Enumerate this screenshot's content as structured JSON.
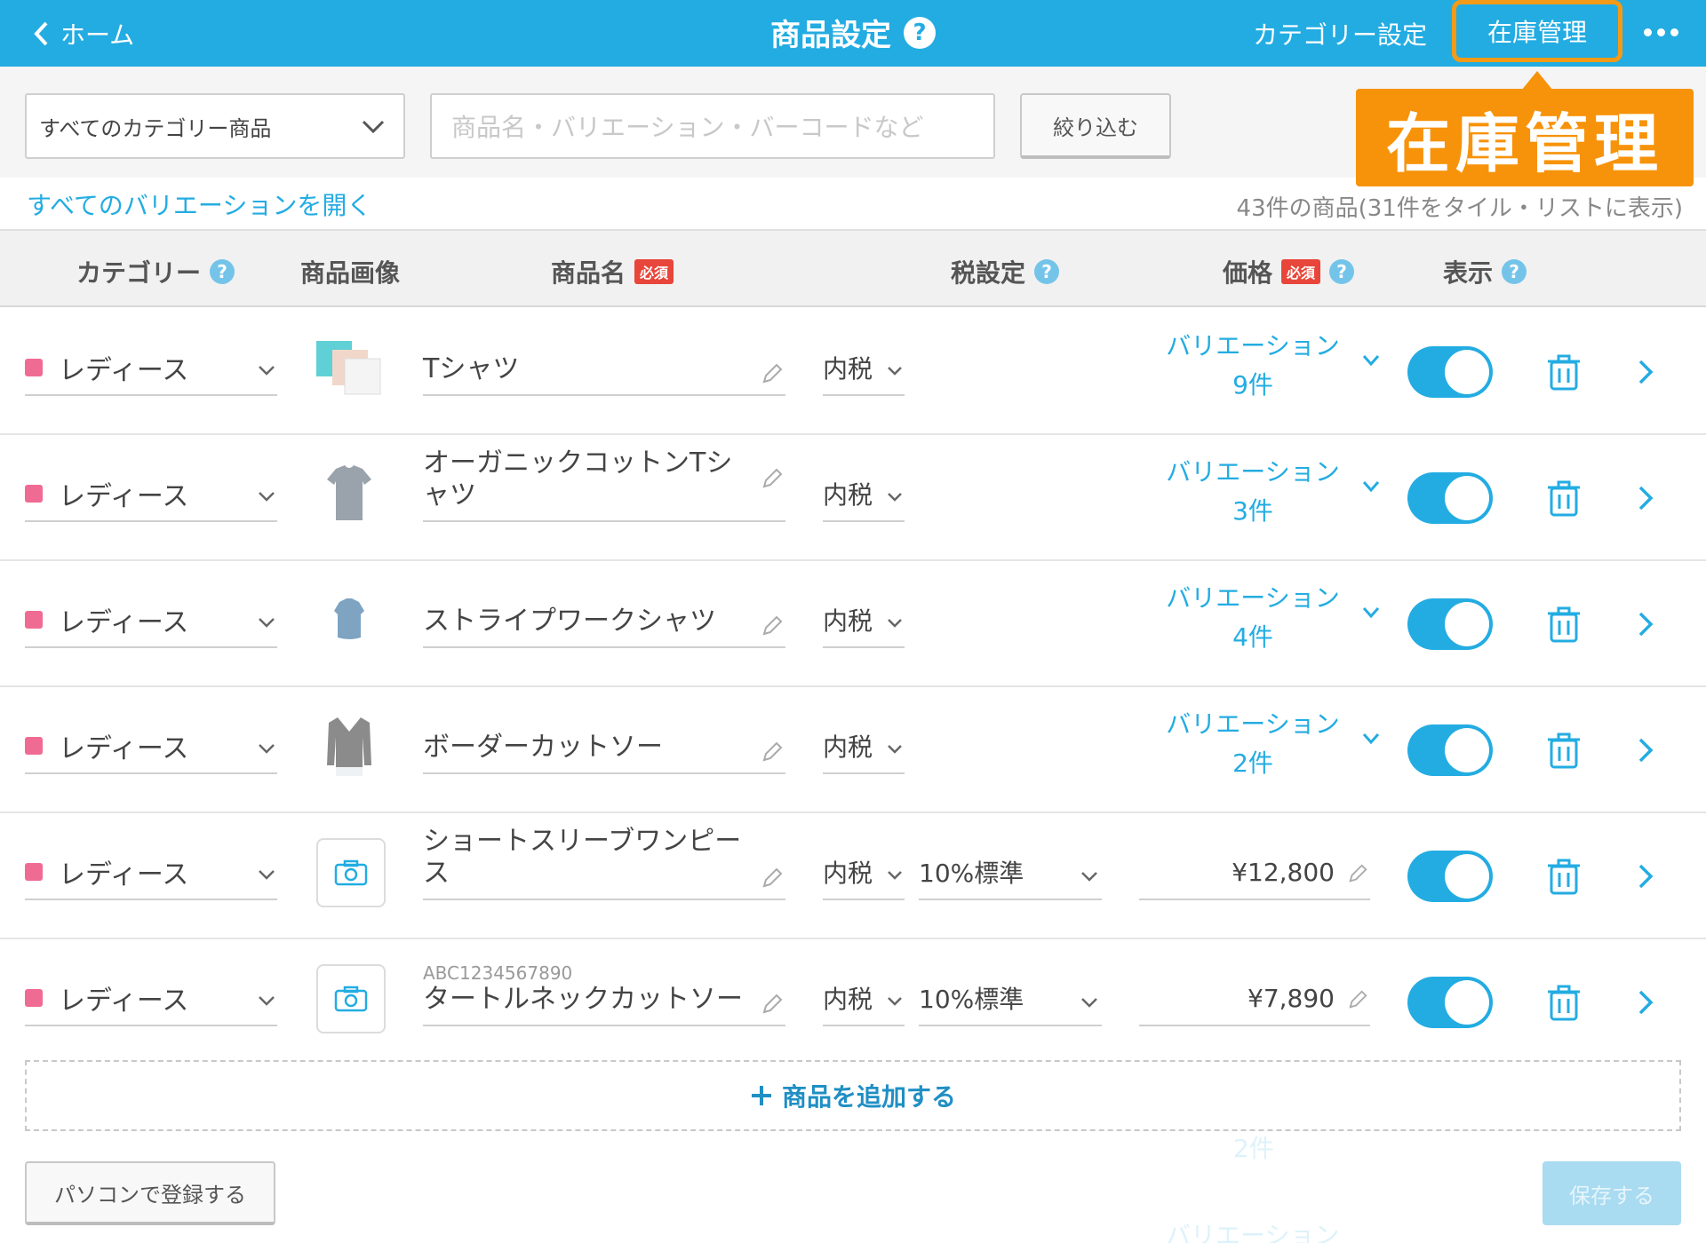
{
  "header": {
    "back_label": "ホーム",
    "title": "商品設定",
    "help": "?",
    "category_settings": "カテゴリー設定",
    "stock_management": "在庫管理"
  },
  "callout": {
    "text": "在庫管理"
  },
  "filter": {
    "category_select": "すべてのカテゴリー商品",
    "search_placeholder": "商品名・バリエーション・バーコードなど",
    "filter_button": "絞り込む"
  },
  "open_all_variations": "すべてのバリエーションを開く",
  "product_count": "43件の商品(31件をタイル・リストに表示)",
  "columns": {
    "category": "カテゴリー",
    "image": "商品画像",
    "name": "商品名",
    "tax": "税設定",
    "price": "価格",
    "display": "表示",
    "required": "必須",
    "help": "?"
  },
  "rows": [
    {
      "category": "レディース",
      "name": "Tシャツ",
      "tax": "内税",
      "variation_label": "バリエーション",
      "variation_count": "9件"
    },
    {
      "category": "レディース",
      "name": "オーガニックコットンTシャツ",
      "tax": "内税",
      "variation_label": "バリエーション",
      "variation_count": "3件"
    },
    {
      "category": "レディース",
      "name": "ストライプワークシャツ",
      "tax": "内税",
      "variation_label": "バリエーション",
      "variation_count": "4件"
    },
    {
      "category": "レディース",
      "name": "ボーダーカットソー",
      "tax": "内税",
      "variation_label": "バリエーション",
      "variation_count": "2件"
    },
    {
      "category": "レディース",
      "name": "ショートスリーブワンピース",
      "tax": "内税",
      "tax_rate": "10%標準",
      "price": "¥12,800"
    },
    {
      "category": "レディース",
      "barcode": "ABC1234567890",
      "name": "タートルネックカットソー",
      "tax": "内税",
      "tax_rate": "10%標準",
      "price": "¥7,890"
    }
  ],
  "add_product": "商品を追加する",
  "ghost": {
    "count": "2件",
    "variation": "バリエーション"
  },
  "footer": {
    "register_pc": "パソコンで登録する",
    "save": "保存する"
  },
  "colors": {
    "primary": "#23ace2",
    "callout": "#f7930a",
    "category_dot": "#f06b93",
    "required": "#e8463a"
  }
}
